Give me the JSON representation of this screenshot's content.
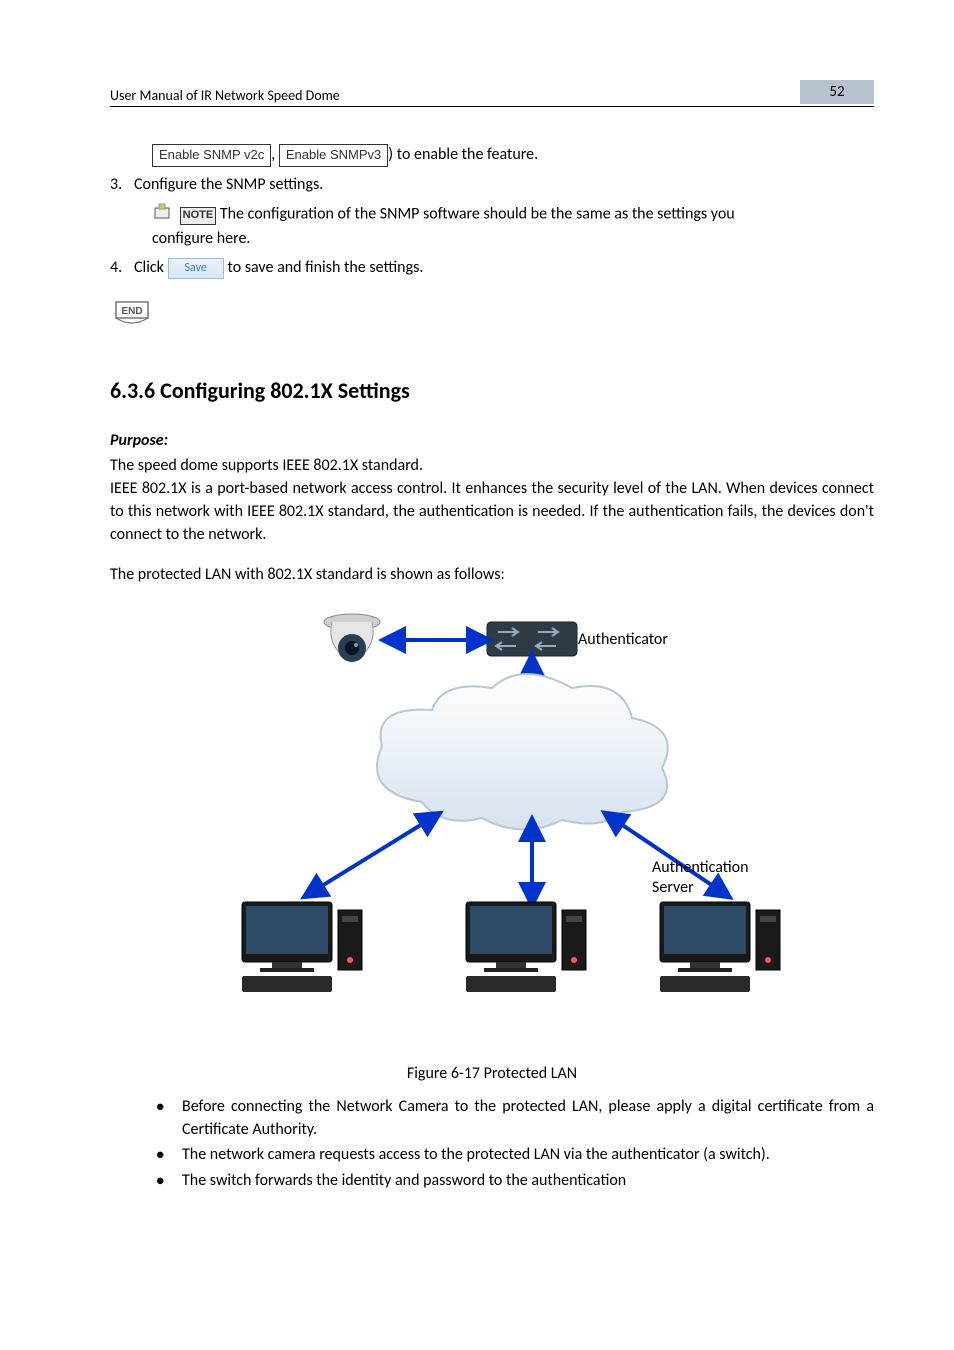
{
  "header": {
    "doc_title": "User Manual of IR Network Speed Dome",
    "page_number": "52"
  },
  "snmp_line": {
    "box_v2c": "Enable SNMP v2c",
    "sep": ", ",
    "box_v3": "Enable SNMPv3",
    "suffix": ") to enable the feature."
  },
  "step3": {
    "num": "3.",
    "text": "Configure the SNMP settings."
  },
  "note": {
    "label": "NOTE",
    "text_a": " The configuration of the SNMP software should be the same as the settings you ",
    "text_b": "configure here."
  },
  "step4": {
    "num": "4.",
    "prefix": "Click ",
    "btn": "Save",
    "suffix": " to save and finish the settings."
  },
  "end_label": "END",
  "section_heading": "6.3.6  Configuring 802.1X Settings",
  "purpose_label": "Purpose:",
  "para1": "The speed dome supports IEEE 802.1X standard.",
  "para2": "IEEE 802.1X is a port-based network access control. It enhances the security level of the LAN. When devices connect to this network with IEEE 802.1X standard, the authentication is needed. If the authentication fails, the devices don't connect to the network.",
  "para3": "The protected LAN with 802.1X standard is shown as follows:",
  "diagram": {
    "authenticator": "Authenticator",
    "auth_server_l1": "Authentication",
    "auth_server_l2": "Server"
  },
  "figure_caption": "Figure 6-17 Protected LAN",
  "bullets": {
    "b1": "Before connecting the Network Camera to the protected LAN, please apply a digital certificate from a Certificate Authority.",
    "b2": "The network camera requests access to the protected LAN via the authenticator (a switch).",
    "b3": "The switch forwards the identity and password to the authentication"
  }
}
